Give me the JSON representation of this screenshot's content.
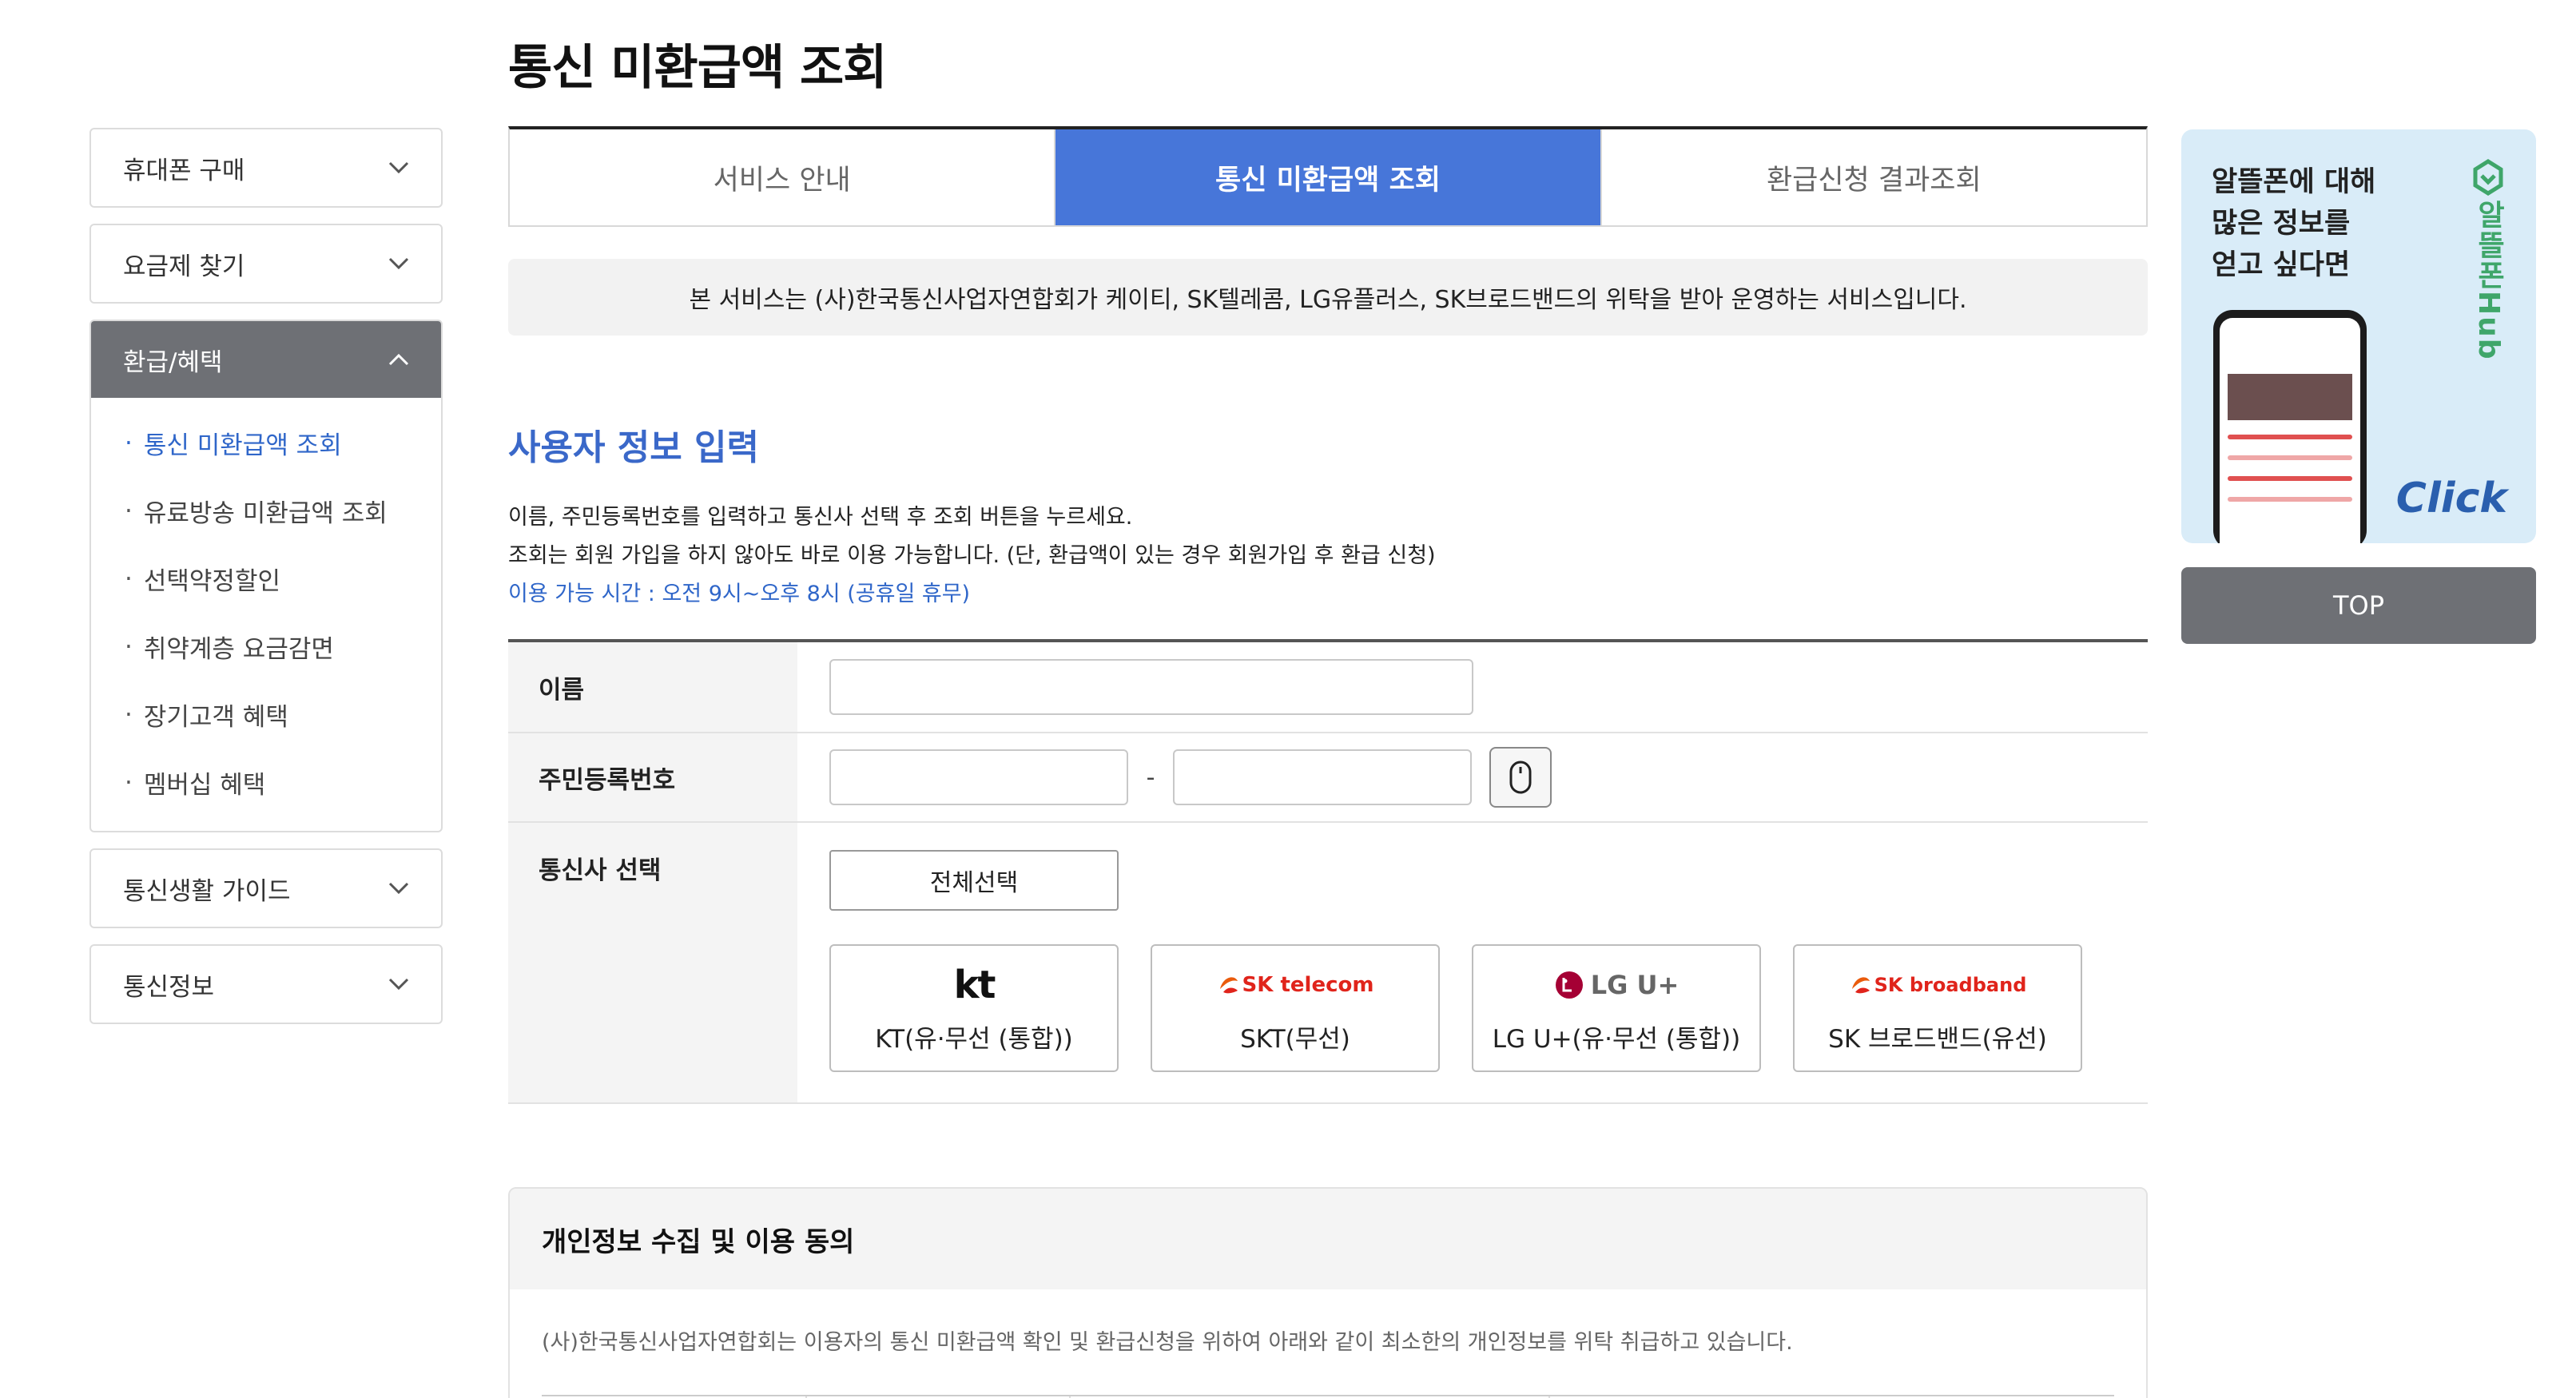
{
  "page_title": "통신 미환급액 조회",
  "sidebar": {
    "menus": [
      {
        "label": "휴대폰 구매",
        "open": false
      },
      {
        "label": "요금제 찾기",
        "open": false
      },
      {
        "label": "환급/혜택",
        "open": true
      },
      {
        "label": "통신생활 가이드",
        "open": false
      },
      {
        "label": "통신정보",
        "open": false
      }
    ],
    "sub_items": [
      {
        "label": "통신 미환급액 조회",
        "active": true
      },
      {
        "label": "유료방송 미환급액 조회",
        "active": false
      },
      {
        "label": "선택약정할인",
        "active": false
      },
      {
        "label": "취약계층 요금감면",
        "active": false
      },
      {
        "label": "장기고객 혜택",
        "active": false
      },
      {
        "label": "멤버십 혜택",
        "active": false
      }
    ],
    "bullet": "·"
  },
  "tabs": [
    {
      "label": "서비스 안내",
      "active": false
    },
    {
      "label": "통신 미환급액 조회",
      "active": true
    },
    {
      "label": "환급신청 결과조회",
      "active": false
    }
  ],
  "notice": "본 서비스는 (사)한국통신사업자연합회가 케이티, SK텔레콤, LG유플러스, SK브로드밴드의 위탁을 받아 운영하는 서비스입니다.",
  "section_title": "사용자 정보 입력",
  "description": {
    "line1": "이름, 주민등록번호를 입력하고 통신사 선택 후 조회 버튼을 누르세요.",
    "line2": "조회는 회원 가입을 하지 않아도 바로 이용 가능합니다. (단, 환급액이 있는 경우 회원가입 후 환급 신청)",
    "hours": "이용 가능 시간 : 오전 9시~오후 8시 (공휴일 휴무)"
  },
  "form": {
    "name_label": "이름",
    "name_value": "",
    "jumin_label": "주민등록번호",
    "jumin_front": "",
    "jumin_back": "",
    "jumin_separator": "-",
    "carrier_label": "통신사 선택",
    "select_all": "전체선택",
    "carriers": [
      {
        "logo": "kt",
        "name": "KT(유·무선 (통합))"
      },
      {
        "logo": "SK telecom",
        "name": "SKT(무선)"
      },
      {
        "logo": "LG U+",
        "name": "LG U+(유·무선 (통합))"
      },
      {
        "logo": "SK broadband",
        "name": "SK 브로드밴드(유선)"
      }
    ]
  },
  "consent": {
    "title": "개인정보 수집 및 이용 동의",
    "text": "(사)한국통신사업자연합회는 이용자의 통신 미환급액 확인 및 환급신청을 위하여 아래와 같이 최소한의 개인정보를 위탁 취급하고 있습니다."
  },
  "banner": {
    "line1": "알뜰폰에 대해",
    "line2": "많은 정보를",
    "line3": "얻고 싶다면",
    "logo_text": "알뜰폰Hub",
    "click": "Click"
  },
  "top_button": "TOP",
  "colors": {
    "accent_blue": "#4776d9",
    "link_blue": "#2f66c9",
    "sidebar_active_bg": "#6e7075",
    "banner_bg": "#d9ecf8",
    "kt_red": "#e0241b",
    "lg_magenta": "#a50034",
    "sk_orange": "#ea5b0c"
  }
}
